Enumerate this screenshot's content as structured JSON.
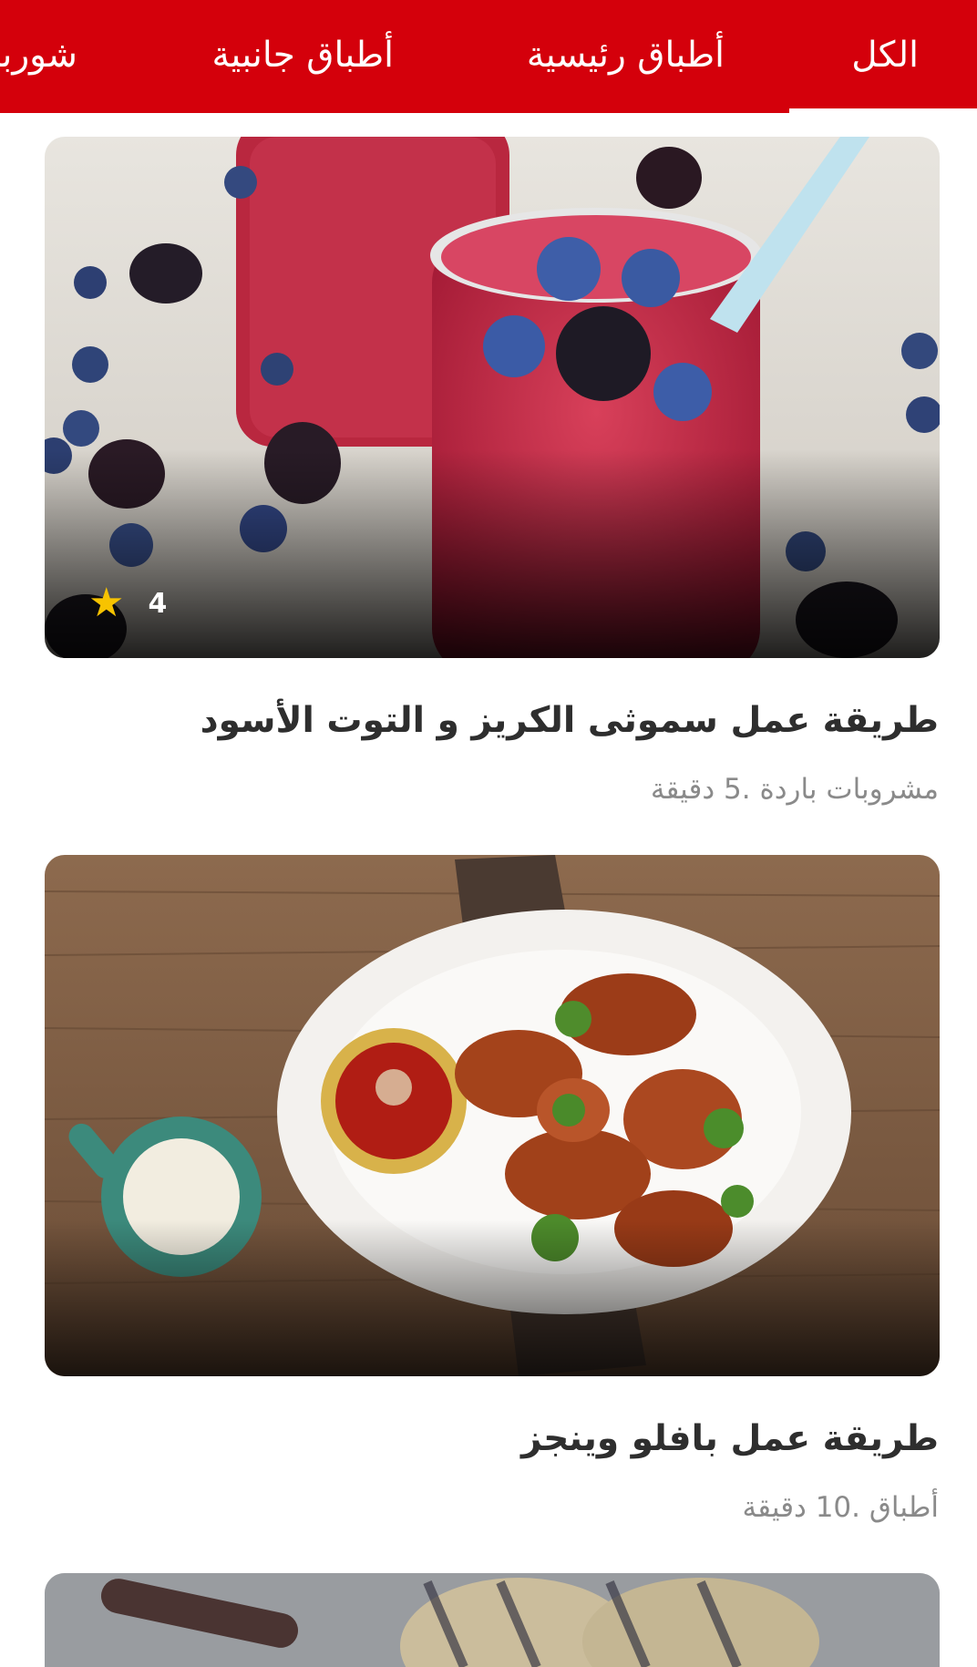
{
  "tabs": [
    {
      "label": "الكل",
      "selected": true
    },
    {
      "label": "أطباق رئيسية",
      "selected": false
    },
    {
      "label": "أطباق جانبية",
      "selected": false
    },
    {
      "label": "شوربات",
      "selected": false
    }
  ],
  "colors": {
    "brand_red": "#d4000b",
    "star": "#f7c300",
    "title": "#2e2e2e",
    "meta": "#8a8a8a"
  },
  "recipes": [
    {
      "title": "طريقة عمل سموثى الكريز و التوت الأسود",
      "meta": "مشروبات باردة .5 دقيقة",
      "rating": "4",
      "image": "berry-smoothie-photo"
    },
    {
      "title": "طريقة عمل بافلو وينجز",
      "meta": "أطباق .10 دقيقة",
      "image": "buffalo-wings-photo"
    },
    {
      "image": "grilled-dish-photo"
    }
  ]
}
